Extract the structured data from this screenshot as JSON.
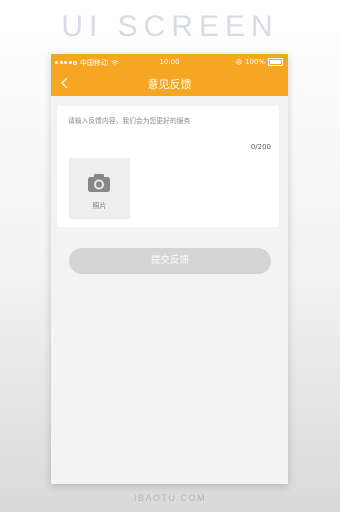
{
  "banner": {
    "title": "UI SCREEN"
  },
  "statusbar": {
    "carrier": "中国移动",
    "time": "10:00",
    "battery": "100%"
  },
  "nav": {
    "title": "意见反馈",
    "back_icon": "chevron-left-icon"
  },
  "feedback": {
    "placeholder": "请输入反馈内容，我们会为您更好的服务",
    "counter": "0/200",
    "photo_label": "照片",
    "photo_icon": "camera-icon"
  },
  "submit": {
    "label": "提交反馈"
  },
  "footer": {
    "text": "IBAOTU.COM"
  },
  "colors": {
    "accent": "#f5a623",
    "button_disabled": "#d4d4d4",
    "page_bg": "#f3f3f3"
  }
}
